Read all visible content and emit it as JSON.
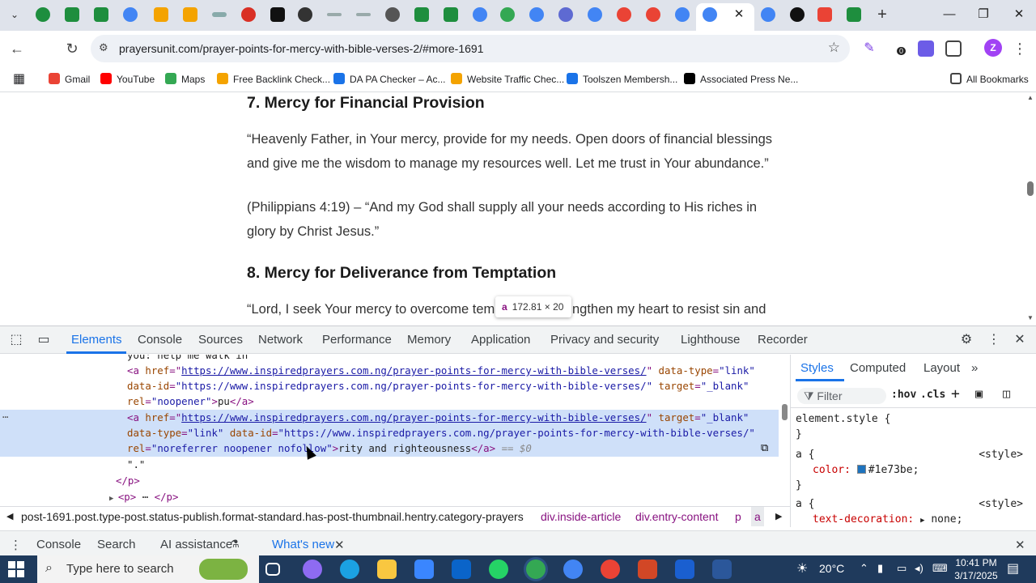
{
  "browser": {
    "active_tab_close": "✕",
    "new_tab": "+",
    "window": {
      "minimize": "—",
      "restore": "❐",
      "close": "✕"
    },
    "url": "prayersunit.com/prayer-points-for-mercy-with-bible-verses-2/#more-1691",
    "ext_badge": "0",
    "profile_initial": "Z",
    "bookmarks": [
      {
        "label": "Gmail",
        "color": "#ea4335"
      },
      {
        "label": "YouTube",
        "color": "#ff0000"
      },
      {
        "label": "Maps",
        "color": "#34a853"
      },
      {
        "label": "Free Backlink Check...",
        "color": "#f4a300"
      },
      {
        "label": "DA PA Checker – Ac...",
        "color": "#1a73e8"
      },
      {
        "label": "Website Traffic Chec...",
        "color": "#f4a300"
      },
      {
        "label": "Toolszen Membersh...",
        "color": "#1a73e8"
      },
      {
        "label": "Associated Press Ne...",
        "color": "#000000"
      }
    ],
    "all_bookmarks": "All Bookmarks"
  },
  "article": {
    "h7": "7. Mercy for Financial Provision",
    "p7": "“Heavenly Father, in Your mercy, provide for my needs. Open doors of financial blessings and give me the wisdom to manage my resources well. Let me trust in Your abundance.”",
    "v7": "(Philippians 4:19) – “And my God shall supply all your needs according to His riches in glory by Christ Jesus.”",
    "h8": "8. Mercy for Deliverance from Temptation",
    "p8_start": "“Lord, I seek Your mercy to overcome tem",
    "p8_end": "ngthen my heart to resist sin and"
  },
  "inspector_tooltip": {
    "tag": "a",
    "size": "172.81 × 20"
  },
  "devtools": {
    "tabs": [
      "Elements",
      "Console",
      "Sources",
      "Network",
      "Performance",
      "Memory",
      "Application",
      "Privacy and security",
      "Lighthouse",
      "Recorder"
    ],
    "dom": {
      "line0": "you: help me walk in",
      "url": "https://www.inspiredprayers.com.ng/prayer-points-for-mercy-with-bible-verses/",
      "text1": "pu",
      "text2": "rity and righteousness",
      "eq": "== $0",
      "after": "\".\"",
      "close_p": "</p>",
      "next_p_open": "<p>",
      "next_p_dots": "⋯",
      "next_p_close": "</p>",
      "sel_dots": "⋯"
    },
    "breadcrumbs": [
      "post-1691.post.type-post.status-publish.format-standard.has-post-thumbnail.hentry.category-prayers",
      "div.inside-article",
      "div.entry-content",
      "p",
      "a"
    ],
    "styles_tabs": [
      "Styles",
      "Computed",
      "Layout"
    ],
    "styles_filter": "Filter",
    "styles_hov": ":hov",
    "styles_cls": ".cls",
    "rules": {
      "element_style": "element.style {",
      "close": "}",
      "a_open": "a {",
      "src": "<style>",
      "color_prop": "color:",
      "color_val": "#1e73be;",
      "deco_prop": "text-decoration:",
      "deco_val": "none;"
    },
    "drawer_tabs": [
      "Console",
      "Search",
      "AI assistance",
      "What's new"
    ]
  },
  "taskbar": {
    "search_placeholder": "Type here to search",
    "temp": "20°C",
    "time": "10:41 PM",
    "date": "3/17/2025"
  }
}
